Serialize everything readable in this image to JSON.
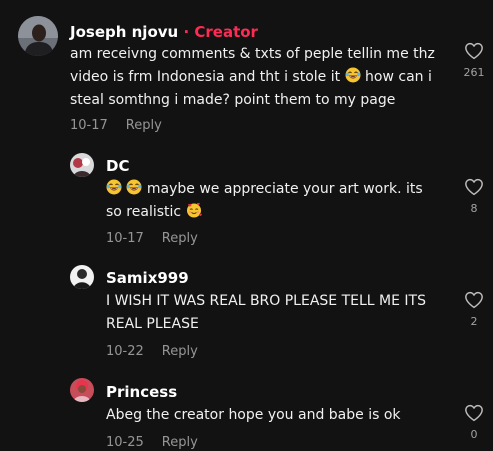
{
  "comments": [
    {
      "username": "Joseph njovu",
      "creator_label": "Creator",
      "text_lines": [
        "am receivng comments & txts of peple tellin me thz",
        "video is frm Indonesia and tht i stole it",
        "how can i",
        "steal somthng i made? point them to my page"
      ],
      "date": "10-17",
      "reply_label": "Reply",
      "likes": "261"
    },
    {
      "username": "DC",
      "text_lines": [
        "maybe we appreciate your art work. its",
        "so realistic"
      ],
      "date": "10-17",
      "reply_label": "Reply",
      "likes": "8"
    },
    {
      "username": "Samix999",
      "text_lines": [
        "I WISH IT WAS REAL BRO PLEASE TELL ME ITS",
        "REAL PLEASE"
      ],
      "date": "10-22",
      "reply_label": "Reply",
      "likes": "2"
    },
    {
      "username": "Princess",
      "text_lines": [
        "Abeg the creator hope you and babe is ok"
      ],
      "date": "10-25",
      "reply_label": "Reply",
      "likes": "0"
    }
  ],
  "icons": {
    "like": "heart-outline-icon",
    "laugh": "laughing-tears-emoji",
    "love": "smiling-face-with-hearts-emoji"
  },
  "colors": {
    "background": "#121212",
    "creator": "#fe2c55",
    "secondary_text": "#8a8a8a"
  }
}
